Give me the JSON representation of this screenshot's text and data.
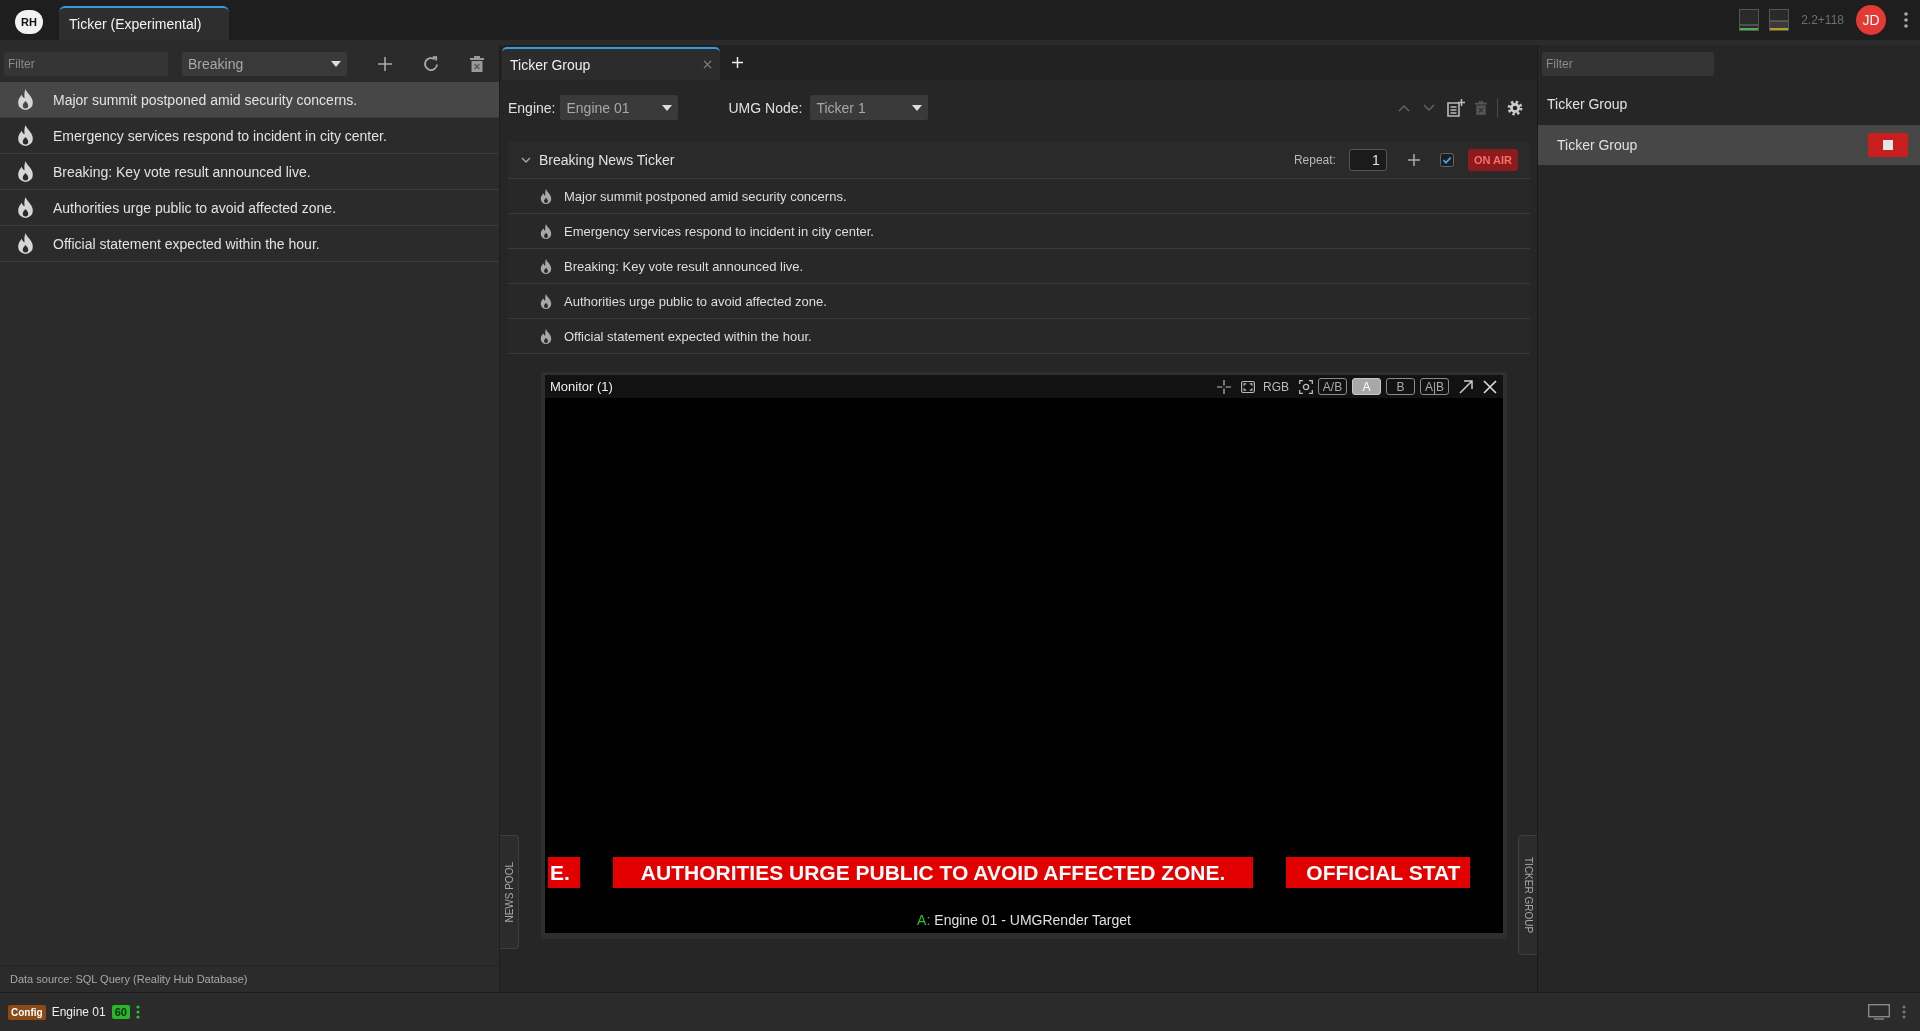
{
  "app_bar": {
    "logo": "RH",
    "tabs": [
      {
        "label": "Ticker (Experimental)",
        "selected": true
      }
    ],
    "stats": "2.2+118",
    "user_initials": "JD"
  },
  "news_pool": {
    "filter": {
      "placeholder": "Filter"
    },
    "category": "Breaking",
    "items": [
      {
        "text": "Major summit postponed amid security concerns.",
        "selected": true
      },
      {
        "text": "Emergency services respond to incident in city center.",
        "selected": false
      },
      {
        "text": "Breaking: Key vote result announced live.",
        "selected": false
      },
      {
        "text": "Authorities urge public to avoid affected zone.",
        "selected": false
      },
      {
        "text": "Official statement expected within the hour.",
        "selected": false
      }
    ],
    "data_source": "Data source: SQL Query (Reality Hub Database)"
  },
  "editor": {
    "tabs": [
      {
        "label": "Ticker Group",
        "selected": true
      }
    ],
    "engine_label": "Engine:",
    "engine": "Engine 01",
    "node_label": "UMG Node:",
    "node": "Ticker 1",
    "group": {
      "title": "Breaking News Ticker",
      "expanded": true,
      "repeat_label": "Repeat:",
      "repeat": "1",
      "enabled": true,
      "status": "ON AIR",
      "live": true,
      "items": [
        {
          "text": "Major summit postponed amid security concerns."
        },
        {
          "text": "Emergency services respond to incident in city center."
        },
        {
          "text": "Breaking: Key vote result announced live."
        },
        {
          "text": "Authorities urge public to avoid affected zone."
        },
        {
          "text": "Official statement expected within the hour."
        }
      ]
    },
    "monitor": {
      "title": "Monitor (1)",
      "channel": "RGB",
      "view_modes": [
        {
          "label": "A/B",
          "selected": false
        },
        {
          "label": "A",
          "selected": true
        },
        {
          "label": "B",
          "selected": false
        },
        {
          "label": "A|B",
          "selected": false
        }
      ],
      "ticker": [
        "E.",
        "AUTHORITIES URGE PUBLIC TO AVOID AFFECTED ZONE.",
        "OFFICIAL STAT"
      ],
      "source_label": "A:",
      "source": "Engine 01 - UMGRender Target"
    },
    "side_tabs": [
      {
        "label": "NEWS POOL"
      },
      {
        "label": "TICKER GROUP"
      }
    ]
  },
  "ticker_groups": {
    "filter": {
      "placeholder": "Filter"
    },
    "title": "Ticker Group",
    "items": [
      {
        "label": "Ticker Group",
        "selected": true,
        "playing": true
      }
    ]
  },
  "status_bar": {
    "mode": "Config",
    "engine": "Engine 01",
    "fps": "60"
  }
}
